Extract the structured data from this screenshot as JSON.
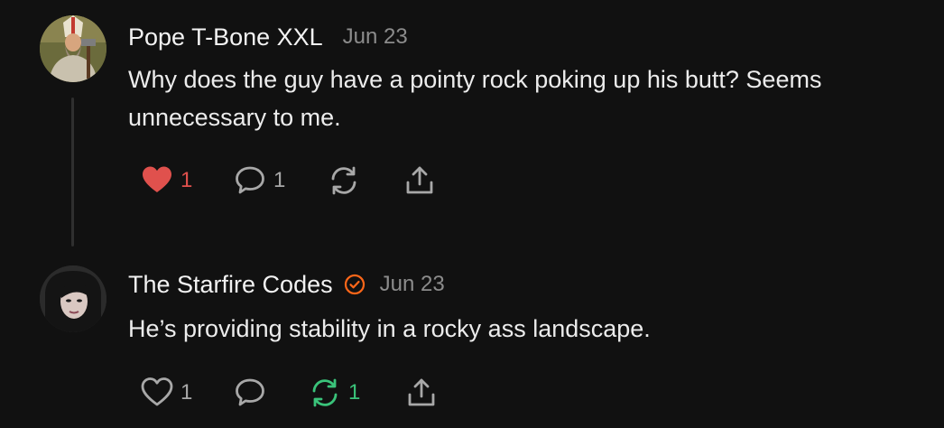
{
  "colors": {
    "background": "#111111",
    "like_active": "#e0514d",
    "restack_active": "#3ac37a",
    "verified_badge": "#ff6719",
    "muted": "#8c8c8c"
  },
  "comments": [
    {
      "author": "Pope T-Bone XXL",
      "date": "Jun 23",
      "verified": false,
      "body": "Why does the guy have a pointy rock poking up his butt? Seems unnecessary to me.",
      "likes": "1",
      "liked": true,
      "replies": "1",
      "restacks": "",
      "restacked": false
    },
    {
      "author": "The Starfire Codes",
      "date": "Jun 23",
      "verified": true,
      "body": "He’s providing stability in a rocky ass landscape.",
      "likes": "1",
      "liked": false,
      "replies": "",
      "restacks": "1",
      "restacked": true
    }
  ],
  "icons": {
    "like": "heart-icon",
    "reply": "speech-bubble-icon",
    "restack": "restack-arrows-icon",
    "share": "share-upload-icon",
    "verified": "verified-check-badge-icon"
  }
}
